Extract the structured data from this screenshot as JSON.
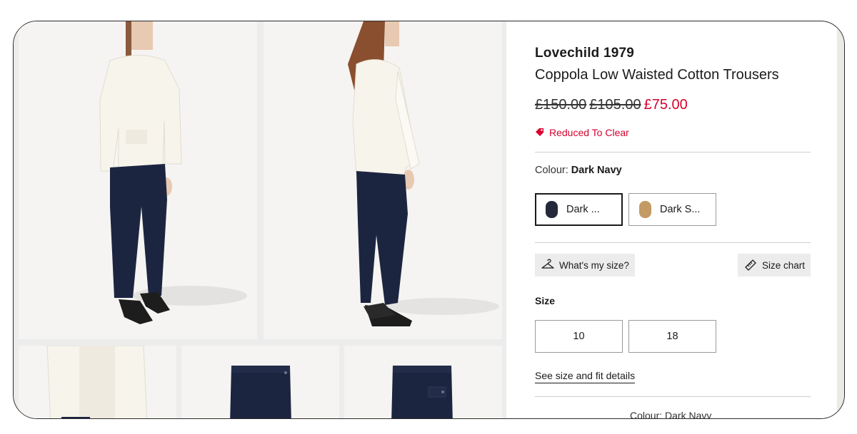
{
  "product": {
    "brand": "Lovechild 1979",
    "title": "Coppola Low Waisted Cotton Trousers",
    "price_was_1": "£150.00",
    "price_was_2": "£105.00",
    "price_now": "£75.00",
    "promo_label": "Reduced To Clear"
  },
  "colour": {
    "label": "Colour:",
    "selected": "Dark Navy",
    "options": [
      {
        "label": "Dark ...",
        "swatch": "#23293a"
      },
      {
        "label": "Dark S...",
        "swatch": "#c39a64"
      }
    ]
  },
  "size_tools": {
    "whats_my_size": "What's my size?",
    "size_chart": "Size chart"
  },
  "sizes": {
    "label": "Size",
    "options": [
      "10",
      "18"
    ]
  },
  "fit_link": "See size and fit details",
  "footer_colour": "Colour: Dark Navy",
  "colors": {
    "sale_red": "#d8002e",
    "trouser_navy": "#1c2540",
    "top_cream": "#f7f4ec"
  }
}
